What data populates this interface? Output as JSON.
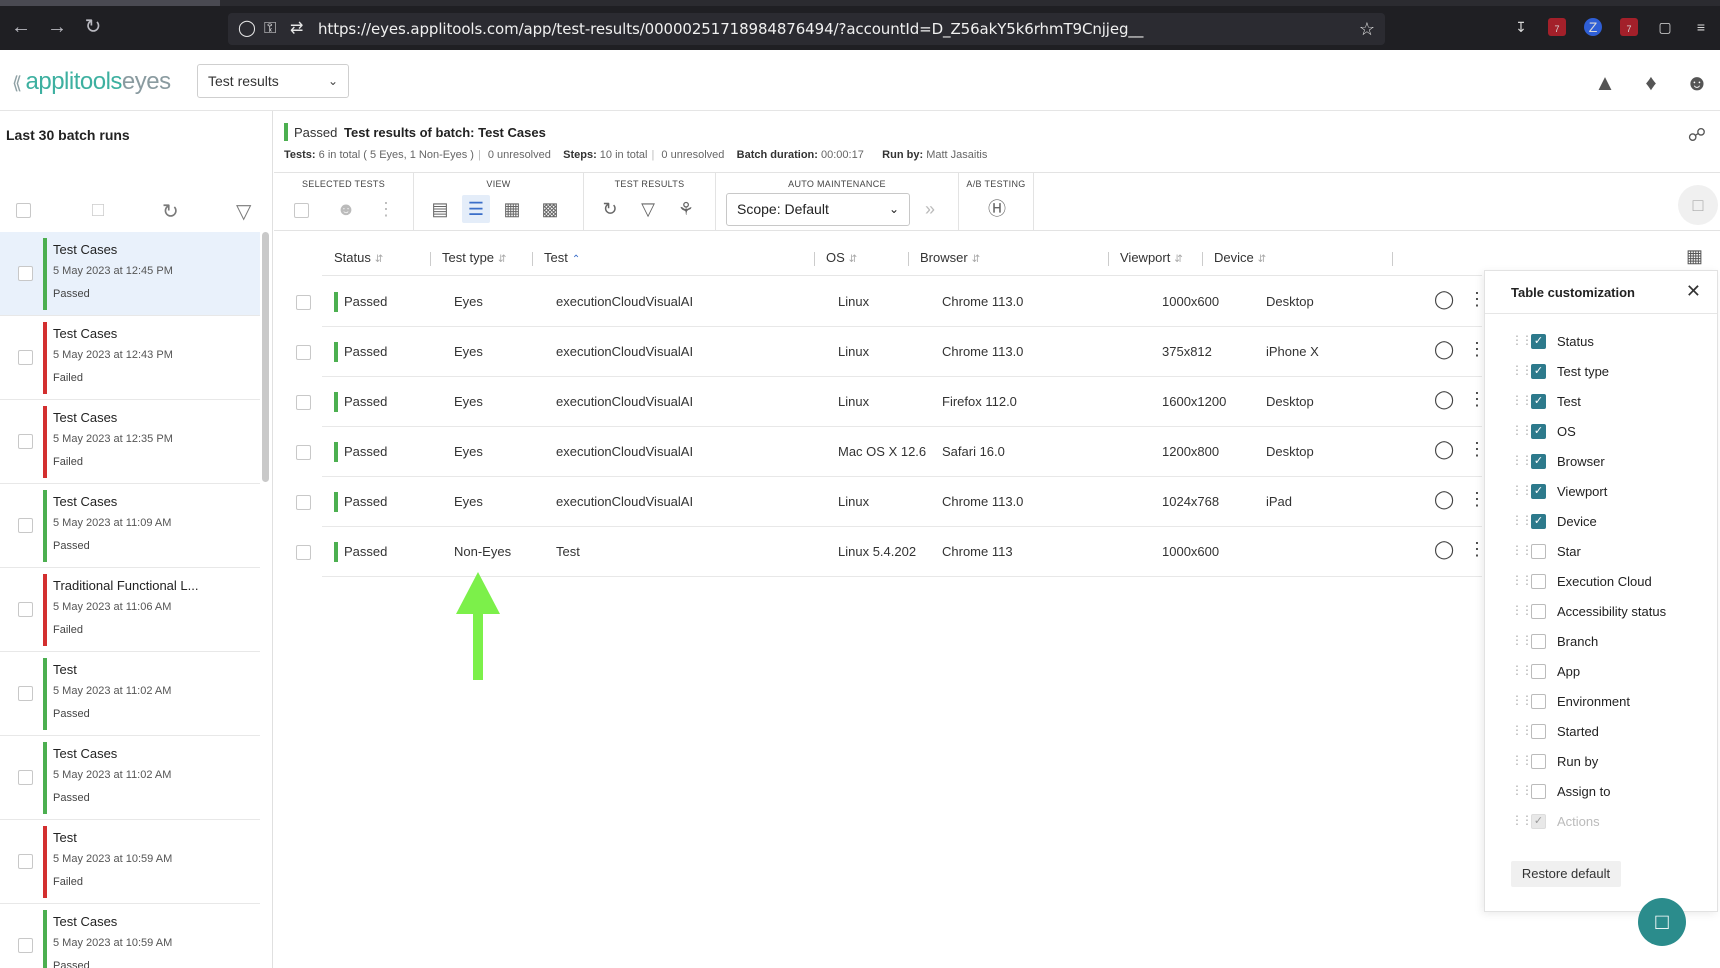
{
  "browser": {
    "url": "https://eyes.applitools.com/app/test-results/00000251718984876494/?accountId=D_Z56akY5k6rhmT9Cnjjeg__",
    "ext_badge_1": "7",
    "ext_badge_2": "7"
  },
  "header": {
    "logo_main": "applitools",
    "logo_sub": "eyes",
    "page_select": "Test results"
  },
  "sidebar": {
    "title": "Last 30 batch runs",
    "batches": [
      {
        "name": "Test Cases",
        "date": "5 May 2023 at 12:45 PM",
        "status": "Passed",
        "color": "#4caf50",
        "selected": true
      },
      {
        "name": "Test Cases",
        "date": "5 May 2023 at 12:43 PM",
        "status": "Failed",
        "color": "#d32f2f"
      },
      {
        "name": "Test Cases",
        "date": "5 May 2023 at 12:35 PM",
        "status": "Failed",
        "color": "#d32f2f"
      },
      {
        "name": "Test Cases",
        "date": "5 May 2023 at 11:09 AM",
        "status": "Passed",
        "color": "#4caf50"
      },
      {
        "name": "Traditional Functional L...",
        "date": "5 May 2023 at 11:06 AM",
        "status": "Failed",
        "color": "#d32f2f"
      },
      {
        "name": "Test",
        "date": "5 May 2023 at 11:02 AM",
        "status": "Passed",
        "color": "#4caf50"
      },
      {
        "name": "Test Cases",
        "date": "5 May 2023 at 11:02 AM",
        "status": "Passed",
        "color": "#4caf50"
      },
      {
        "name": "Test",
        "date": "5 May 2023 at 10:59 AM",
        "status": "Failed",
        "color": "#d32f2f"
      },
      {
        "name": "Test Cases",
        "date": "5 May 2023 at 10:59 AM",
        "status": "Passed",
        "color": "#4caf50"
      }
    ]
  },
  "batch": {
    "status": "Passed",
    "title": "Test results of batch: Test Cases",
    "tests_label": "Tests:",
    "tests_value": "6 in total ( 5 Eyes, 1 Non-Eyes )",
    "tests_unresolved": "0 unresolved",
    "steps_label": "Steps:",
    "steps_value": "10 in total",
    "steps_unresolved": "0 unresolved",
    "duration_label": "Batch duration:",
    "duration_value": "00:00:17",
    "runby_label": "Run by:",
    "runby_value": "Matt Jasaitis"
  },
  "toolbar": {
    "selected_tests": "SELECTED TESTS",
    "view": "VIEW",
    "test_results": "TEST RESULTS",
    "auto_maintenance": "AUTO MAINTENANCE",
    "ab_testing": "A/B TESTING",
    "scope": "Scope: Default"
  },
  "table": {
    "columns": [
      "Status",
      "Test type",
      "Test",
      "OS",
      "Browser",
      "Viewport",
      "Device"
    ],
    "rows": [
      {
        "status": "Passed",
        "type": "Eyes",
        "test": "executionCloudVisualAI",
        "os": "Linux",
        "browser": "Chrome 113.0",
        "viewport": "1000x600",
        "device": "Desktop"
      },
      {
        "status": "Passed",
        "type": "Eyes",
        "test": "executionCloudVisualAI",
        "os": "Linux",
        "browser": "Chrome 113.0",
        "viewport": "375x812",
        "device": "iPhone X"
      },
      {
        "status": "Passed",
        "type": "Eyes",
        "test": "executionCloudVisualAI",
        "os": "Linux",
        "browser": "Firefox 112.0",
        "viewport": "1600x1200",
        "device": "Desktop"
      },
      {
        "status": "Passed",
        "type": "Eyes",
        "test": "executionCloudVisualAI",
        "os": "Mac OS X 12.6",
        "browser": "Safari 16.0",
        "viewport": "1200x800",
        "device": "Desktop"
      },
      {
        "status": "Passed",
        "type": "Eyes",
        "test": "executionCloudVisualAI",
        "os": "Linux",
        "browser": "Chrome 113.0",
        "viewport": "1024x768",
        "device": "iPad"
      },
      {
        "status": "Passed",
        "type": "Non-Eyes",
        "test": "Test",
        "os": "Linux 5.4.202",
        "browser": "Chrome 113",
        "viewport": "1000x600",
        "device": ""
      }
    ]
  },
  "customization": {
    "title": "Table customization",
    "options": [
      {
        "label": "Status",
        "checked": true
      },
      {
        "label": "Test type",
        "checked": true
      },
      {
        "label": "Test",
        "checked": true
      },
      {
        "label": "OS",
        "checked": true
      },
      {
        "label": "Browser",
        "checked": true
      },
      {
        "label": "Viewport",
        "checked": true
      },
      {
        "label": "Device",
        "checked": true
      },
      {
        "label": "Star",
        "checked": false
      },
      {
        "label": "Execution Cloud",
        "checked": false
      },
      {
        "label": "Accessibility status",
        "checked": false
      },
      {
        "label": "Branch",
        "checked": false
      },
      {
        "label": "App",
        "checked": false
      },
      {
        "label": "Environment",
        "checked": false
      },
      {
        "label": "Started",
        "checked": false
      },
      {
        "label": "Run by",
        "checked": false
      },
      {
        "label": "Assign to",
        "checked": false
      },
      {
        "label": "Actions",
        "checked": true,
        "disabled": true
      }
    ],
    "restore": "Restore default"
  },
  "colors": {
    "passed": "#4caf50",
    "failed": "#d32f2f",
    "annotation_arrow": "#7cf04a",
    "accent": "#2d7a8c"
  }
}
